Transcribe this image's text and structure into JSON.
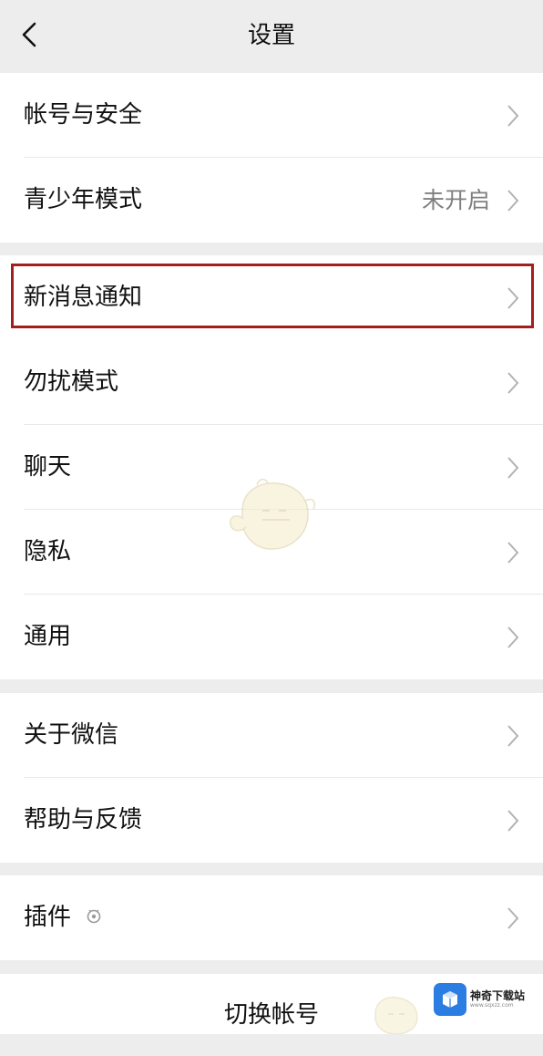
{
  "header": {
    "title": "设置",
    "back_icon": "chevron-left-icon"
  },
  "groups": [
    {
      "items": [
        {
          "label": "帐号与安全",
          "value": ""
        },
        {
          "label": "青少年模式",
          "value": "未开启"
        }
      ]
    },
    {
      "items": [
        {
          "label": "新消息通知",
          "value": ""
        },
        {
          "label": "勿扰模式",
          "value": ""
        },
        {
          "label": "聊天",
          "value": ""
        },
        {
          "label": "隐私",
          "value": ""
        },
        {
          "label": "通用",
          "value": ""
        }
      ]
    },
    {
      "items": [
        {
          "label": "关于微信",
          "value": ""
        },
        {
          "label": "帮助与反馈",
          "value": ""
        }
      ]
    },
    {
      "items": [
        {
          "label": "插件",
          "value": ""
        }
      ]
    }
  ],
  "switch_account": "切换帐号",
  "watermark": {
    "brand": "神奇下载站",
    "site": "www.sqxzz.com"
  },
  "colors": {
    "background": "#ededed",
    "highlight_border": "#a31e1e",
    "secondary_text": "#7f7f7f"
  }
}
